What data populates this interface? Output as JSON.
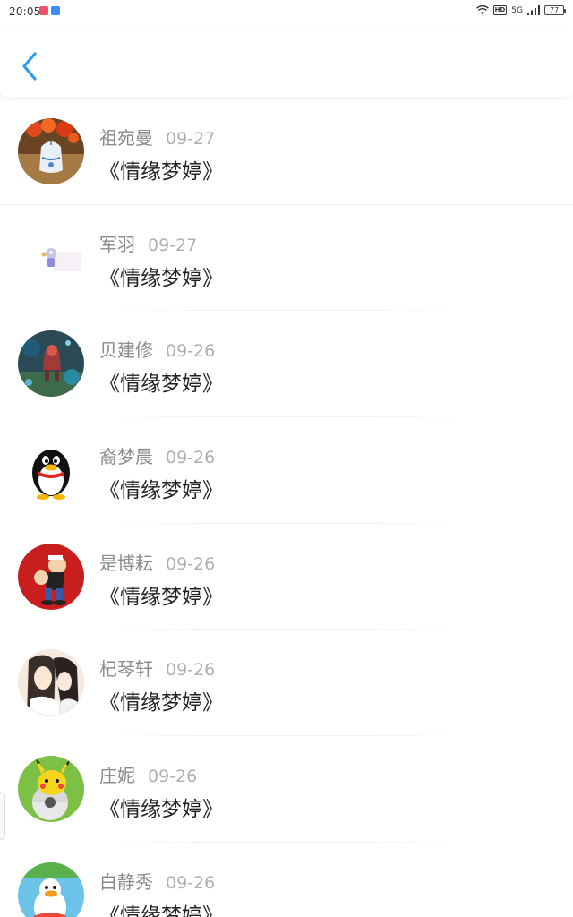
{
  "status_bar": {
    "time": "20:05",
    "battery": "77",
    "network": "5G",
    "hd": "HD"
  },
  "header": {
    "back_icon": "chevron-left-icon",
    "accent": "#2a9df4"
  },
  "items": [
    {
      "name": "祖宛曼",
      "date": "09-27",
      "title": "《情缘梦婷》",
      "avatar": "wind-chime"
    },
    {
      "name": "军羽",
      "date": "09-27",
      "title": "《情缘梦婷》",
      "avatar": "small-cartoon"
    },
    {
      "name": "贝建修",
      "date": "09-26",
      "title": "《情缘梦婷》",
      "avatar": "game-scene"
    },
    {
      "name": "裔梦晨",
      "date": "09-26",
      "title": "《情缘梦婷》",
      "avatar": "qq-penguin"
    },
    {
      "name": "是博耘",
      "date": "09-26",
      "title": "《情缘梦婷》",
      "avatar": "popeye"
    },
    {
      "name": "杞琴轩",
      "date": "09-26",
      "title": "《情缘梦婷》",
      "avatar": "anime-girl"
    },
    {
      "name": "庄妮",
      "date": "09-26",
      "title": "《情缘梦婷》",
      "avatar": "pikachu"
    },
    {
      "name": "白静秀",
      "date": "09-26",
      "title": "《情缘梦婷》",
      "avatar": "cartoon-duck"
    }
  ]
}
